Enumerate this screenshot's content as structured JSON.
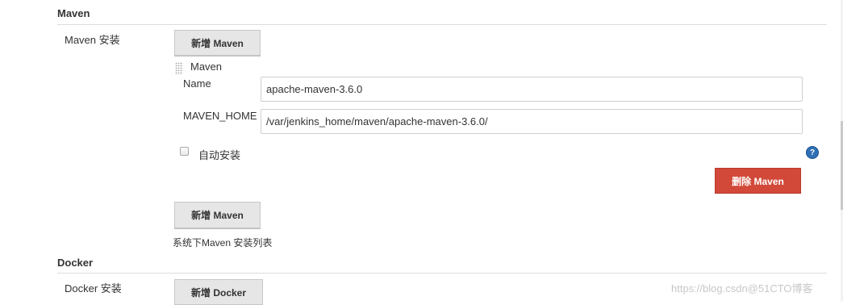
{
  "maven": {
    "section_title": "Maven",
    "install_label": "Maven 安装",
    "add_button_top": "新增 Maven",
    "item_title": "Maven",
    "name_label": "Name",
    "name_value": "apache-maven-3.6.0",
    "home_label": "MAVEN_HOME",
    "home_value": "/var/jenkins_home/maven/apache-maven-3.6.0/",
    "auto_install_label": "自动安装",
    "auto_install_checked": false,
    "help_icon": "help-icon",
    "delete_button": "删除 Maven",
    "add_button_bottom": "新增 Maven",
    "list_caption": "系统下Maven 安装列表"
  },
  "docker": {
    "section_title": "Docker",
    "install_label": "Docker 安装",
    "add_button": "新增 Docker"
  },
  "watermark": "https://blog.csdn@51CTO博客",
  "colors": {
    "danger": "#d24939",
    "help": "#2f6fb5",
    "rule": "#dcdcdc"
  }
}
